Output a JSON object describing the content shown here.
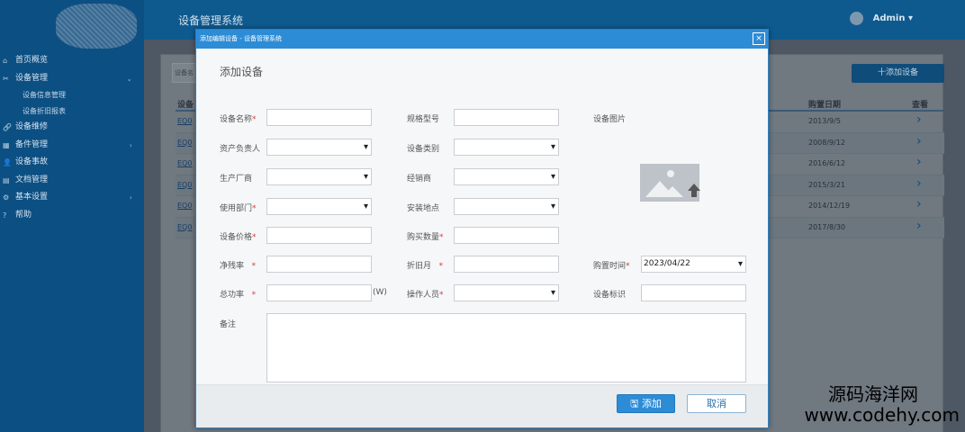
{
  "app": {
    "title": "设备管理系统",
    "user": "Admin",
    "caret": "▾"
  },
  "sidebar": {
    "items": [
      {
        "icon": "⌂",
        "label": "首页概览",
        "arrow": ""
      },
      {
        "icon": "✂",
        "label": "设备管理",
        "arrow": "⌄"
      },
      {
        "icon": "🔗",
        "label": "设备维修",
        "arrow": ""
      },
      {
        "icon": "▦",
        "label": "备件管理",
        "arrow": "›"
      },
      {
        "icon": "👤",
        "label": "设备事故",
        "arrow": ""
      },
      {
        "icon": "▤",
        "label": "文档管理",
        "arrow": ""
      },
      {
        "icon": "⚙",
        "label": "基本设置",
        "arrow": "›"
      },
      {
        "icon": "?",
        "label": "帮助",
        "arrow": ""
      }
    ],
    "subitems": [
      "设备信息管理",
      "设备折旧报表"
    ]
  },
  "list": {
    "search_placeholder": "设备名",
    "add_button": "十添加设备",
    "columns": [
      "设备",
      "购置日期",
      "查看"
    ],
    "rows": [
      {
        "code": "EQ0",
        "date": "2013/9/5"
      },
      {
        "code": "EQ0",
        "date": "2008/9/12"
      },
      {
        "code": "EQ0",
        "date": "2016/6/12"
      },
      {
        "code": "EQ0",
        "date": "2015/3/21"
      },
      {
        "code": "EQ0",
        "date": "2014/12/19"
      },
      {
        "code": "EQ0",
        "date": "2017/8/30"
      }
    ],
    "view_glyph": "›"
  },
  "modal": {
    "window_title": "添加编辑设备 - 设备管理系统",
    "close_glyph": "×",
    "form_title": "添加设备",
    "labels": {
      "name": "设备名称",
      "model": "规格型号",
      "photo": "设备图片",
      "owner": "资产负责人",
      "category": "设备类别",
      "manufacturer": "生产厂商",
      "dealer": "经销商",
      "department": "使用部门",
      "location": "安装地点",
      "price": "设备价格",
      "quantity": "购买数量",
      "residual": "净残率",
      "depreciation_month": "折旧月",
      "purchase_time": "购置时间",
      "power": "总功率",
      "operator": "操作人员",
      "tag": "设备标识",
      "remark": "备注"
    },
    "values": {
      "purchase_time": "2023/04/22"
    },
    "power_unit": "(W)",
    "required_mark": "*",
    "add_button": "添加",
    "cancel_button": "取消"
  },
  "watermark": {
    "line1": "源码海洋网",
    "line2": "www.codehy.com"
  }
}
